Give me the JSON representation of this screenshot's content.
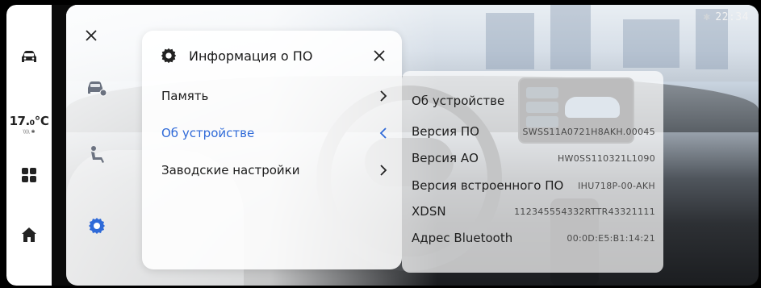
{
  "status": {
    "time": "22:34",
    "bluetooth_icon": "bluetooth-icon"
  },
  "dock": {
    "temperature": "17.₀℃",
    "fan_label": "\\\\\\\\ ✱",
    "items": [
      "car-icon",
      "apps-icon",
      "home-icon"
    ]
  },
  "nav": {
    "close_icon": "close-icon",
    "items": [
      "car-settings-icon",
      "seat-icon",
      "gear-icon"
    ],
    "active_index": 2
  },
  "panel": {
    "title": "Информация о ПО",
    "menu": [
      {
        "label": "Память",
        "chevron": "chevron-right-icon"
      },
      {
        "label": "Об устройстве",
        "chevron": "chevron-left-icon",
        "active": true
      },
      {
        "label": "Заводские настройки",
        "chevron": "chevron-right-icon"
      }
    ]
  },
  "detail": {
    "heading": "Об устройстве",
    "rows": [
      {
        "key": "Версия ПО",
        "value": "SWSS11A0721H8AKH.00045"
      },
      {
        "key": "Версия АО",
        "value": "HW0SS110321L1090"
      },
      {
        "key": "Версия встроенного ПО",
        "value": "IHU718P-00-AKH"
      },
      {
        "key": "XDSN",
        "value": "112345554332RTTR43321111"
      },
      {
        "key": "Адрес Bluetooth",
        "value": "00:0D:E5:B1:14:21"
      }
    ]
  },
  "colors": {
    "accent": "#2f6ad8",
    "dock_bg": "#ffffff",
    "panel_bg": "#ffffff"
  }
}
